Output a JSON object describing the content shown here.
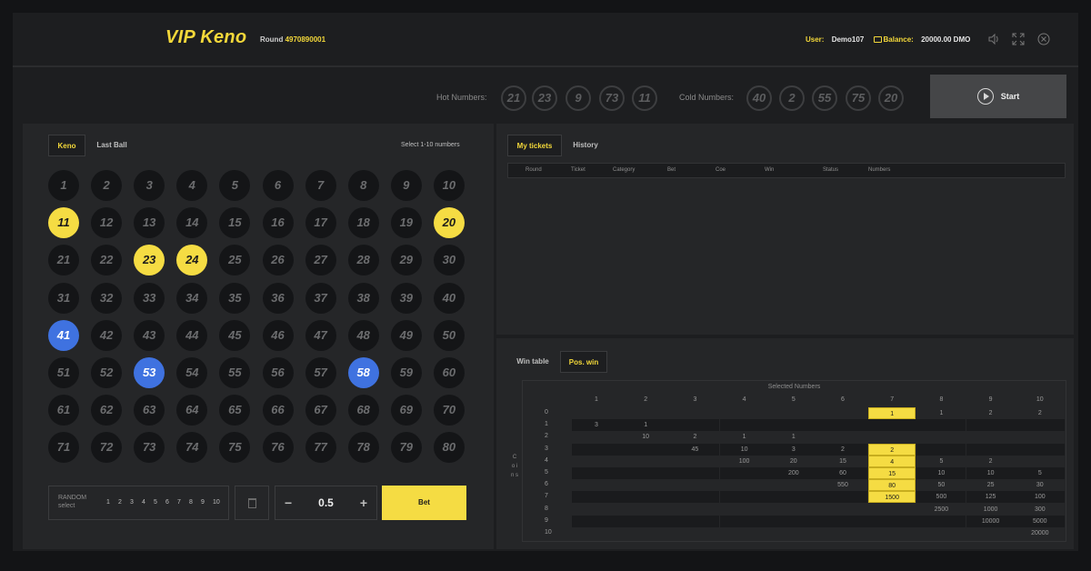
{
  "header": {
    "title": "VIP Keno",
    "round_label": "Round",
    "round_value": "4970890001",
    "user_label": "User:",
    "user_value": "Demo107",
    "balance_label": "Balance:",
    "balance_value": "20000.00 DMO",
    "icons": [
      "sound-icon",
      "fullscreen-icon",
      "close-icon"
    ]
  },
  "hot_cold": {
    "hot_label": "Hot Numbers:",
    "hot": [
      "21",
      "23",
      "9",
      "73",
      "11"
    ],
    "cold_label": "Cold Numbers:",
    "cold": [
      "40",
      "2",
      "55",
      "75",
      "20"
    ]
  },
  "start": {
    "label": "Start"
  },
  "keno": {
    "tabs": [
      "Keno",
      "Last Ball"
    ],
    "hint": "Select 1-10 numbers",
    "selected_yellow": [
      11,
      20,
      23,
      24
    ],
    "drawn_blue": [
      41,
      53,
      58
    ]
  },
  "controls": {
    "random_label_1": "RANDOM",
    "random_label_2": "select",
    "random_numbers": [
      "1",
      "2",
      "3",
      "4",
      "5",
      "6",
      "7",
      "8",
      "9",
      "10"
    ],
    "minus": "−",
    "stake": "0.5",
    "plus": "+",
    "bet_label": "Bet"
  },
  "tickets": {
    "tabs": [
      "My tickets",
      "History"
    ],
    "columns": [
      "Round",
      "Ticket",
      "Category",
      "Bet",
      "Coe",
      "Win",
      "Status",
      "Numbers"
    ]
  },
  "win": {
    "tabs": [
      "Win table",
      "Pos. win"
    ],
    "title": "Selected Numbers",
    "coins_label": "C o i n s",
    "col_headers": [
      "1",
      "2",
      "3",
      "4",
      "5",
      "6",
      "7",
      "8",
      "9",
      "10"
    ],
    "row_headers": [
      "0",
      "1",
      "2",
      "3",
      "4",
      "5",
      "6",
      "7",
      "8",
      "9",
      "10"
    ],
    "rows": [
      [
        "",
        "",
        "",
        "",
        "",
        "",
        "1",
        "1",
        "2",
        "2"
      ],
      [
        "3",
        "1",
        "",
        "",
        "",
        "",
        "",
        "",
        "",
        ""
      ],
      [
        "",
        "10",
        "2",
        "1",
        "1",
        "",
        "",
        "",
        "",
        ""
      ],
      [
        "",
        "",
        "45",
        "10",
        "3",
        "2",
        "2",
        "",
        "",
        ""
      ],
      [
        "",
        "",
        "",
        "100",
        "20",
        "15",
        "4",
        "5",
        "2",
        ""
      ],
      [
        "",
        "",
        "",
        "",
        "200",
        "60",
        "15",
        "10",
        "10",
        "5"
      ],
      [
        "",
        "",
        "",
        "",
        "",
        "550",
        "80",
        "50",
        "25",
        "30"
      ],
      [
        "",
        "",
        "",
        "",
        "",
        "",
        "1500",
        "500",
        "125",
        "100"
      ],
      [
        "",
        "",
        "",
        "",
        "",
        "",
        "",
        "2500",
        "1000",
        "300"
      ],
      [
        "",
        "",
        "",
        "",
        "",
        "",
        "",
        "",
        "10000",
        "5000"
      ],
      [
        "",
        "",
        "",
        "",
        "",
        "",
        "",
        "",
        "",
        "20000"
      ]
    ],
    "highlight_col": 7
  }
}
